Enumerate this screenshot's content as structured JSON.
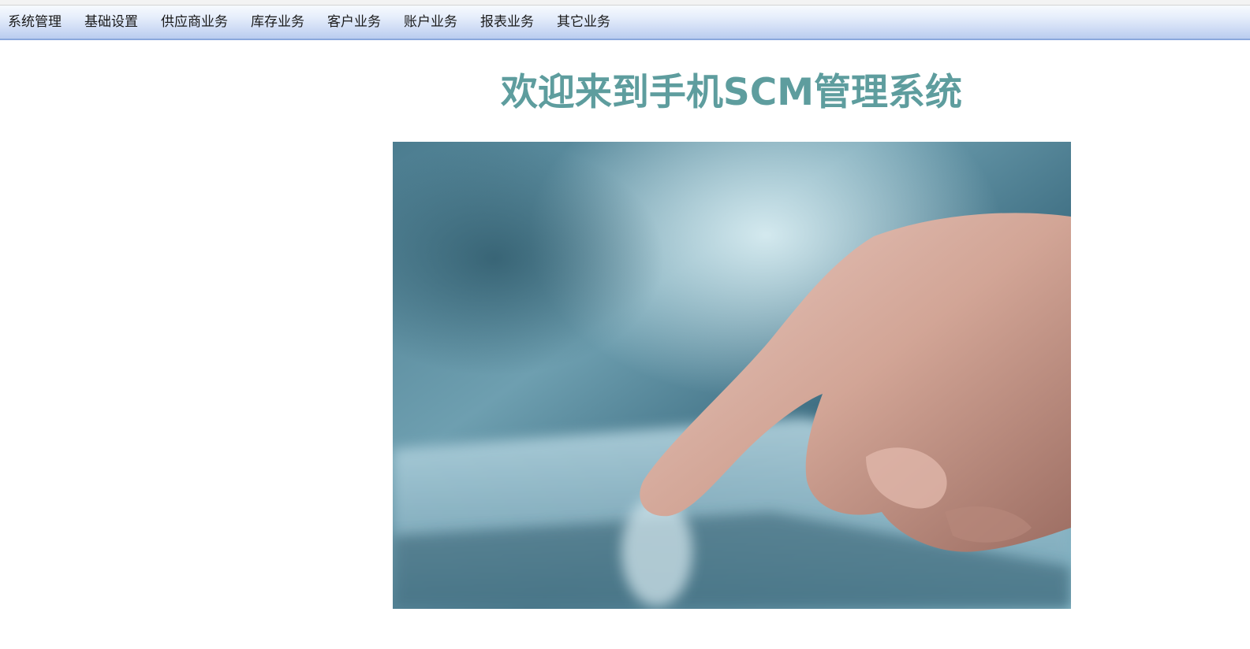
{
  "menu": {
    "items": [
      {
        "label": "系统管理"
      },
      {
        "label": "基础设置"
      },
      {
        "label": "供应商业务"
      },
      {
        "label": "库存业务"
      },
      {
        "label": "客户业务"
      },
      {
        "label": "账户业务"
      },
      {
        "label": "报表业务"
      },
      {
        "label": "其它业务"
      }
    ]
  },
  "main": {
    "title": "欢迎来到手机SCM管理系统"
  },
  "colors": {
    "title": "#5e9d9e",
    "menubar_border": "#8aa8dc"
  }
}
